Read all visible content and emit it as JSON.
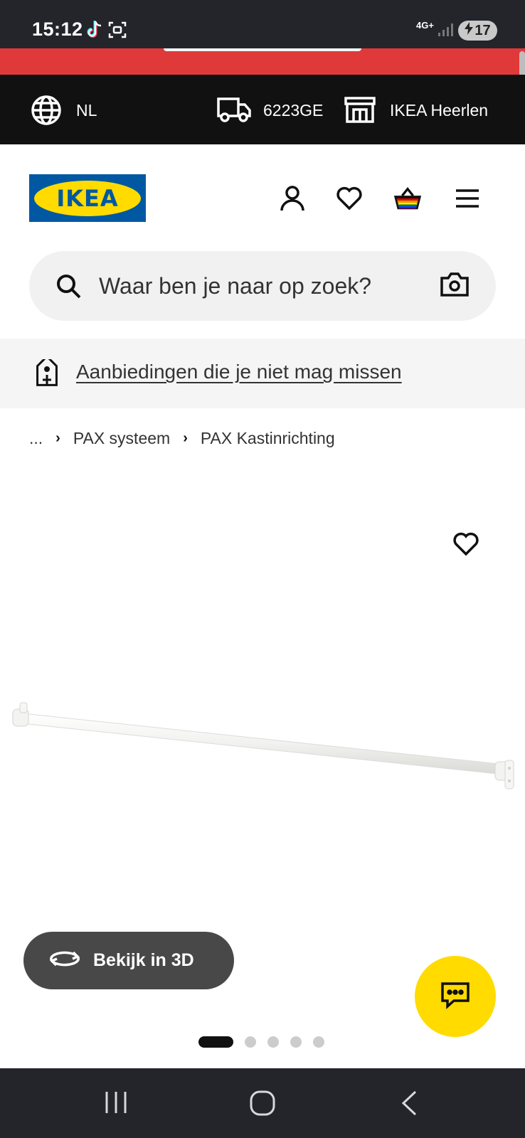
{
  "status_bar": {
    "time": "15:12",
    "network": "4G+",
    "battery": "17"
  },
  "location_bar": {
    "language": "NL",
    "postcode": "6223GE",
    "store": "IKEA Heerlen"
  },
  "header": {
    "logo_text": "IKEA"
  },
  "search": {
    "placeholder": "Waar ben je naar op zoek?"
  },
  "offers": {
    "link_text": "Aanbiedingen die je niet mag missen"
  },
  "breadcrumb": {
    "ellipsis": "...",
    "items": [
      "PAX systeem",
      "PAX Kastinrichting"
    ]
  },
  "product": {
    "view_3d_label": "Bekijk in 3D",
    "gallery": {
      "count": 5,
      "active_index": 0
    }
  },
  "colors": {
    "ikea_blue": "#0058a3",
    "ikea_yellow": "#ffdb00",
    "banner_red": "#e0393a"
  }
}
